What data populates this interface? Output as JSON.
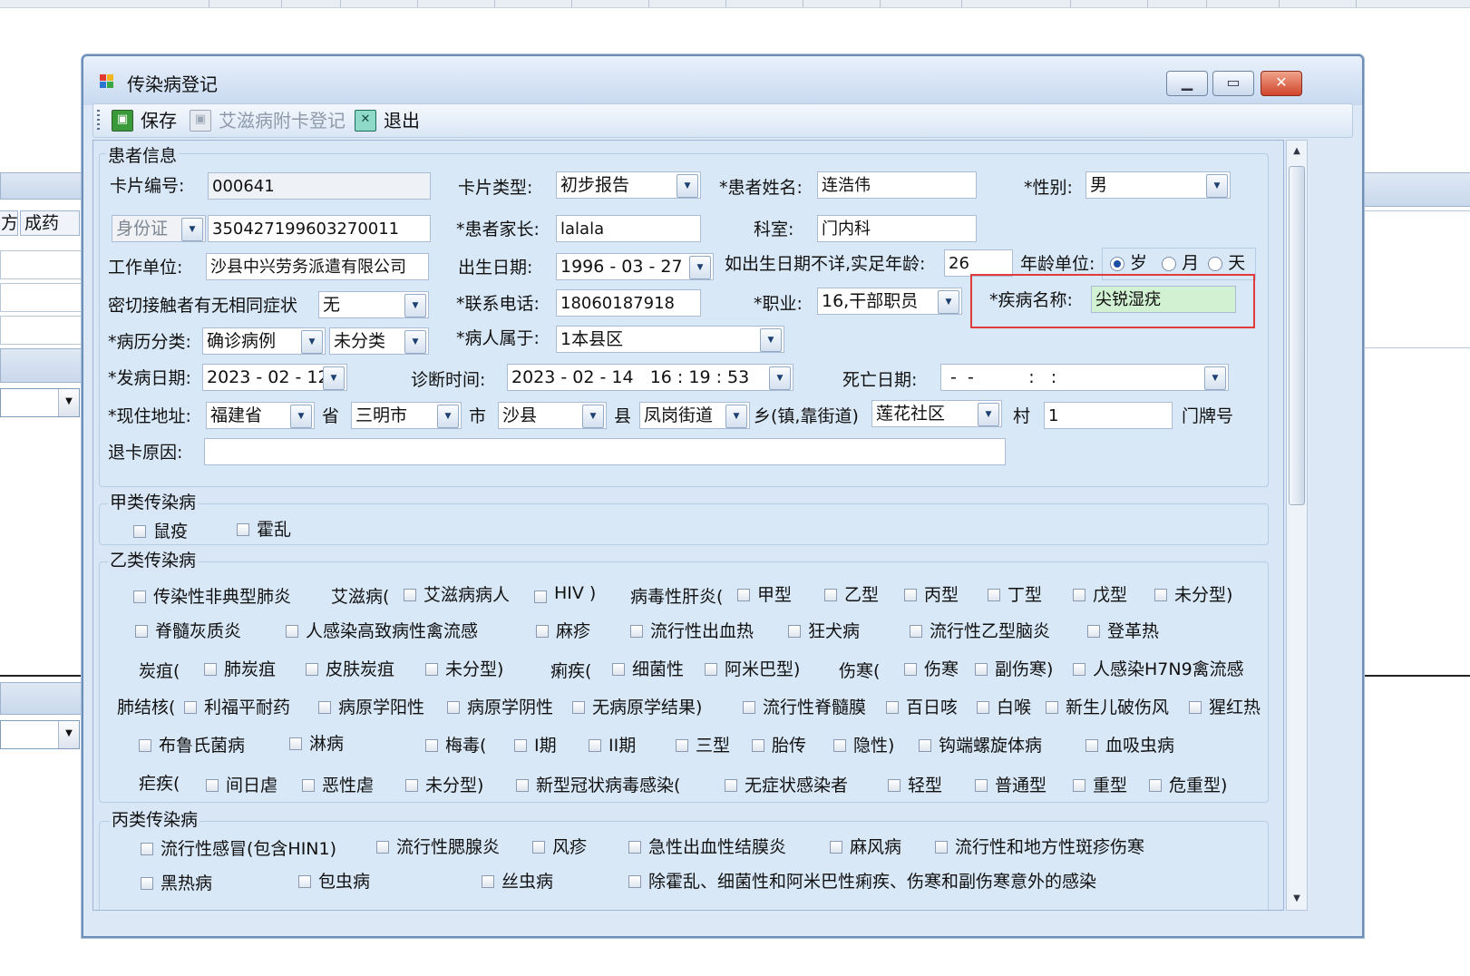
{
  "window": {
    "title": "传染病登记",
    "controls": {
      "minimize": "▁",
      "maximize": "▭",
      "close": "✕"
    }
  },
  "background": {
    "tab_labels": [
      "方",
      "成药"
    ]
  },
  "toolbar": {
    "save": "保存",
    "aids_card": "艾滋病附卡登记",
    "exit": "退出"
  },
  "patient_info": {
    "group_title": "患者信息",
    "card_no_label": "卡片编号:",
    "card_no": "000641",
    "card_type_label": "卡片类型:",
    "card_type": "初步报告",
    "name_label": "*患者姓名:",
    "name": "连浩伟",
    "sex_label": "*性别:",
    "sex": "男",
    "id_type": "身份证",
    "id_number": "350427199603270011",
    "guardian_label": "*患者家长:",
    "guardian": "lalala",
    "dept_label": "科室:",
    "dept": "门内科",
    "employer_label": "工作单位:",
    "employer": "沙县中兴劳务派遣有限公司",
    "birth_label": "出生日期:",
    "birth_date": "1996 - 03 - 27",
    "age_label": "如出生日期不详,实足年龄:",
    "age": "26",
    "age_unit_label": "年龄单位:",
    "age_units": [
      "岁",
      "月",
      "天"
    ],
    "age_unit_selected": "岁",
    "contact_label": "密切接触者有无相同症状",
    "contact_value": "无",
    "phone_label": "*联系电话:",
    "phone": "18060187918",
    "occupation_label": "*职业:",
    "occupation": "16,干部职员",
    "disease_name_label": "*疾病名称:",
    "disease_name": "尖锐湿疣",
    "case_class_label": "*病历分类:",
    "case_class_1": "确诊病例",
    "case_class_2": "未分类",
    "belongs_label": "*病人属于:",
    "belongs": "1本县区",
    "onset_label": "*发病日期:",
    "onset_date": "2023 - 02 - 12",
    "diag_time_label": "诊断时间:",
    "diag_time": "2023 - 02 - 14   16 : 19 : 53",
    "death_label": "死亡日期:",
    "death_date": " -  -          :   :",
    "address_label": "*现住地址:",
    "province": "福建省",
    "province_suffix": "省",
    "city": "三明市",
    "city_suffix": "市",
    "county": "沙县",
    "county_suffix": "县",
    "town": "凤岗街道",
    "town_suffix": "乡(镇,靠街道)",
    "village": "莲花社区",
    "village_suffix": "村",
    "house_no": "1",
    "house_no_suffix": "门牌号",
    "return_reason_label": "退卡原因:",
    "return_reason": ""
  },
  "class_a": {
    "title": "甲类传染病",
    "items": [
      "鼠疫",
      "霍乱"
    ]
  },
  "class_b": {
    "title": "乙类传染病",
    "row1": {
      "sars": "传染性非典型肺炎",
      "aids_prefix": "艾滋病(",
      "aids_patient": "艾滋病病人",
      "hiv": "HIV )",
      "hepatitis_prefix": "病毒性肝炎(",
      "hep_a": "甲型",
      "hep_b": "乙型",
      "hep_c": "丙型",
      "hep_d": "丁型",
      "hep_e": "戊型",
      "hep_unk": "未分型)"
    },
    "row2": [
      "脊髓灰质炎",
      "人感染高致病性禽流感",
      "麻疹",
      "流行性出血热",
      "狂犬病",
      "流行性乙型脑炎",
      "登革热"
    ],
    "row3": {
      "anthrax_prefix": "炭疽(",
      "anthrax_lung": "肺炭疽",
      "anthrax_skin": "皮肤炭疽",
      "anthrax_unk": "未分型)",
      "dysentery_prefix": "痢疾(",
      "dys_bact": "细菌性",
      "dys_amoeba": "阿米巴型)",
      "typhoid_prefix": "伤寒(",
      "typhoid": "伤寒",
      "paratyphoid": "副伤寒)",
      "h7n9": "人感染H7N9禽流感"
    },
    "row4": {
      "tb_prefix": "肺结核(",
      "tb_rif": "利福平耐药",
      "tb_pos": "病原学阳性",
      "tb_neg": "病原学阴性",
      "tb_none": "无病原学结果)",
      "meningitis": "流行性脊髓膜",
      "pertussis": "百日咳",
      "diphtheria": "白喉",
      "neonatal_tetanus": "新生儿破伤风",
      "scarlet": "猩红热"
    },
    "row5": {
      "brucellosis": "布鲁氏菌病",
      "gonorrhea": "淋病",
      "syphilis_prefix": "梅毒(",
      "syp_1": "I期",
      "syp_2": "II期",
      "syp_3": "三型",
      "syp_congenital": "胎传",
      "syp_latent": "隐性)",
      "leptospirosis": "钩端螺旋体病",
      "schistosomiasis": "血吸虫病"
    },
    "row6": {
      "malaria_prefix": "疟疾(",
      "mal_vivax": "间日虐",
      "mal_falc": "恶性虐",
      "mal_unk": "未分型)",
      "covid_prefix": "新型冠状病毒感染(",
      "covid_asym": "无症状感染者",
      "covid_mild": "轻型",
      "covid_normal": "普通型",
      "covid_severe": "重型",
      "covid_critical": "危重型)"
    }
  },
  "class_c": {
    "title": "丙类传染病",
    "row1": [
      "流行性感冒(包含HIN1)",
      "流行性腮腺炎",
      "风疹",
      "急性出血性结膜炎",
      "麻风病",
      "流行性和地方性斑疹伤寒"
    ],
    "row2": [
      "黑热病",
      "包虫病",
      "丝虫病",
      "除霍乱、细菌性和阿米巴性痢疾、伤寒和副伤寒意外的感染"
    ]
  },
  "colors": {
    "window_bg": "#dce8f6",
    "highlight_box": "#e23b3b",
    "disease_field": "#d2f0d2"
  }
}
